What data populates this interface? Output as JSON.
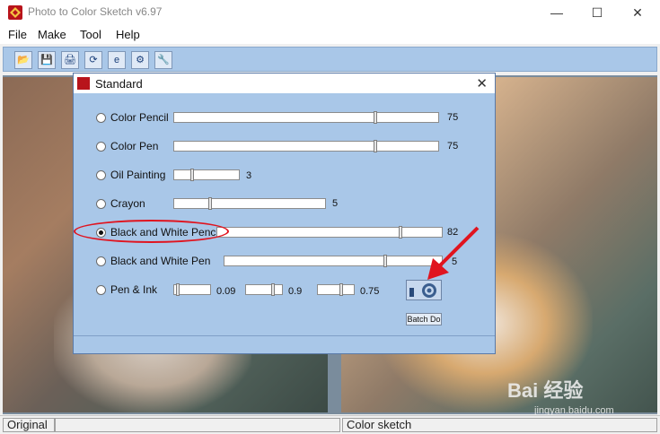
{
  "window": {
    "title": "Photo to Color Sketch v6.97",
    "minimize": "—",
    "maximize": "☐",
    "close": "✕"
  },
  "menu": [
    "File",
    "Make",
    "Tool",
    "Help"
  ],
  "toolbar": {
    "buttons": [
      {
        "name": "open-icon",
        "glyph": "📂"
      },
      {
        "name": "save-icon",
        "glyph": "💾"
      },
      {
        "name": "print-icon",
        "glyph": "🖨"
      },
      {
        "name": "convert-icon",
        "glyph": "⟳"
      },
      {
        "name": "web-icon",
        "glyph": "e"
      },
      {
        "name": "settings-icon",
        "glyph": "⚙"
      },
      {
        "name": "tool-icon",
        "glyph": "🔧"
      }
    ]
  },
  "dialog": {
    "title": "Standard",
    "close": "✕",
    "options": [
      {
        "label": "Color Pencil",
        "value": "75",
        "checked": false
      },
      {
        "label": "Color Pen",
        "value": "75",
        "checked": false
      },
      {
        "label": "Oil Painting",
        "value": "3",
        "checked": false
      },
      {
        "label": "Crayon",
        "value": "5",
        "checked": false
      },
      {
        "label": "Black and White Pencil",
        "value": "82",
        "checked": true
      },
      {
        "label": "Black and White Pen",
        "value": "5",
        "checked": false
      },
      {
        "label": "Pen & Ink",
        "values": [
          "0.09",
          "0.9",
          "0.75"
        ],
        "checked": false
      }
    ],
    "batch_label": "Batch Do"
  },
  "status": {
    "left": "Original",
    "right": "Color sketch"
  },
  "watermark": {
    "main": "Bai 经验",
    "sub": "jingyan.baidu.com"
  },
  "colors": {
    "accent": "#a9c7e8",
    "annotation": "#e0141f",
    "app_icon": "#b8141b"
  }
}
